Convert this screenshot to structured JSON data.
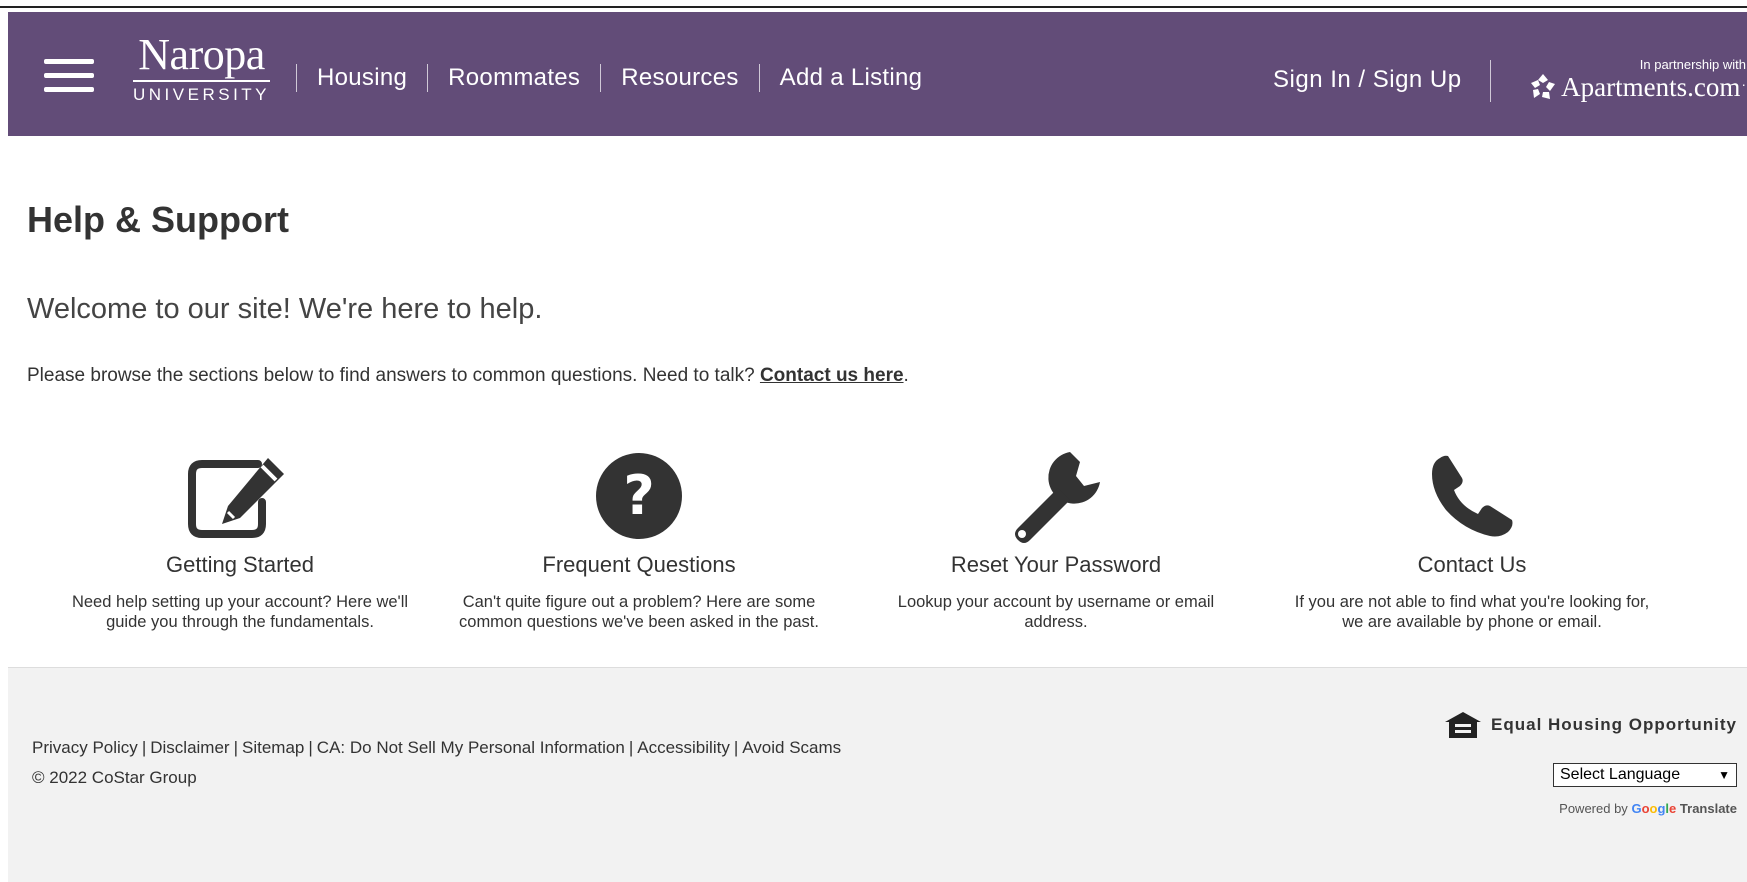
{
  "header": {
    "logo_top": "Naropa",
    "logo_bottom": "UNIVERSITY",
    "nav": [
      "Housing",
      "Roommates",
      "Resources",
      "Add a Listing"
    ],
    "signin": "Sign In / Sign Up",
    "partner_with": "In partnership with",
    "partner_brand": "Apartments.com",
    "partner_tm": "·",
    "bg_color": "#624c78"
  },
  "main": {
    "title": "Help & Support",
    "welcome": "Welcome to our site! We're here to help.",
    "intro_text": "Please browse the sections below to find answers to common questions. Need to talk? ",
    "intro_link": "Contact us here",
    "intro_end": ".",
    "cards": [
      {
        "icon": "edit-icon",
        "title": "Getting Started",
        "desc1": "Need help setting up your account? Here we'll",
        "desc2": "guide you through the fundamentals."
      },
      {
        "icon": "question-icon",
        "title": "Frequent Questions",
        "desc1": "Can't quite figure out a problem? Here are some",
        "desc2": "common questions we've been asked in the past."
      },
      {
        "icon": "wrench-icon",
        "title": "Reset Your Password",
        "desc1": "Lookup your account by username or email",
        "desc2": "address."
      },
      {
        "icon": "phone-icon",
        "title": "Contact Us",
        "desc1": "If you are not able to find what you're looking for,",
        "desc2": "we are available by phone or email."
      }
    ]
  },
  "footer": {
    "links": [
      "Privacy Policy",
      "Disclaimer",
      "Sitemap",
      "CA: Do Not Sell My Personal Information",
      "Accessibility",
      "Avoid Scams"
    ],
    "copyright": "© 2022 CoStar Group",
    "eho": "Equal Housing Opportunity",
    "language_select": "Select Language",
    "powered_by": "Powered by",
    "google": "Google",
    "translate": "Translate"
  }
}
